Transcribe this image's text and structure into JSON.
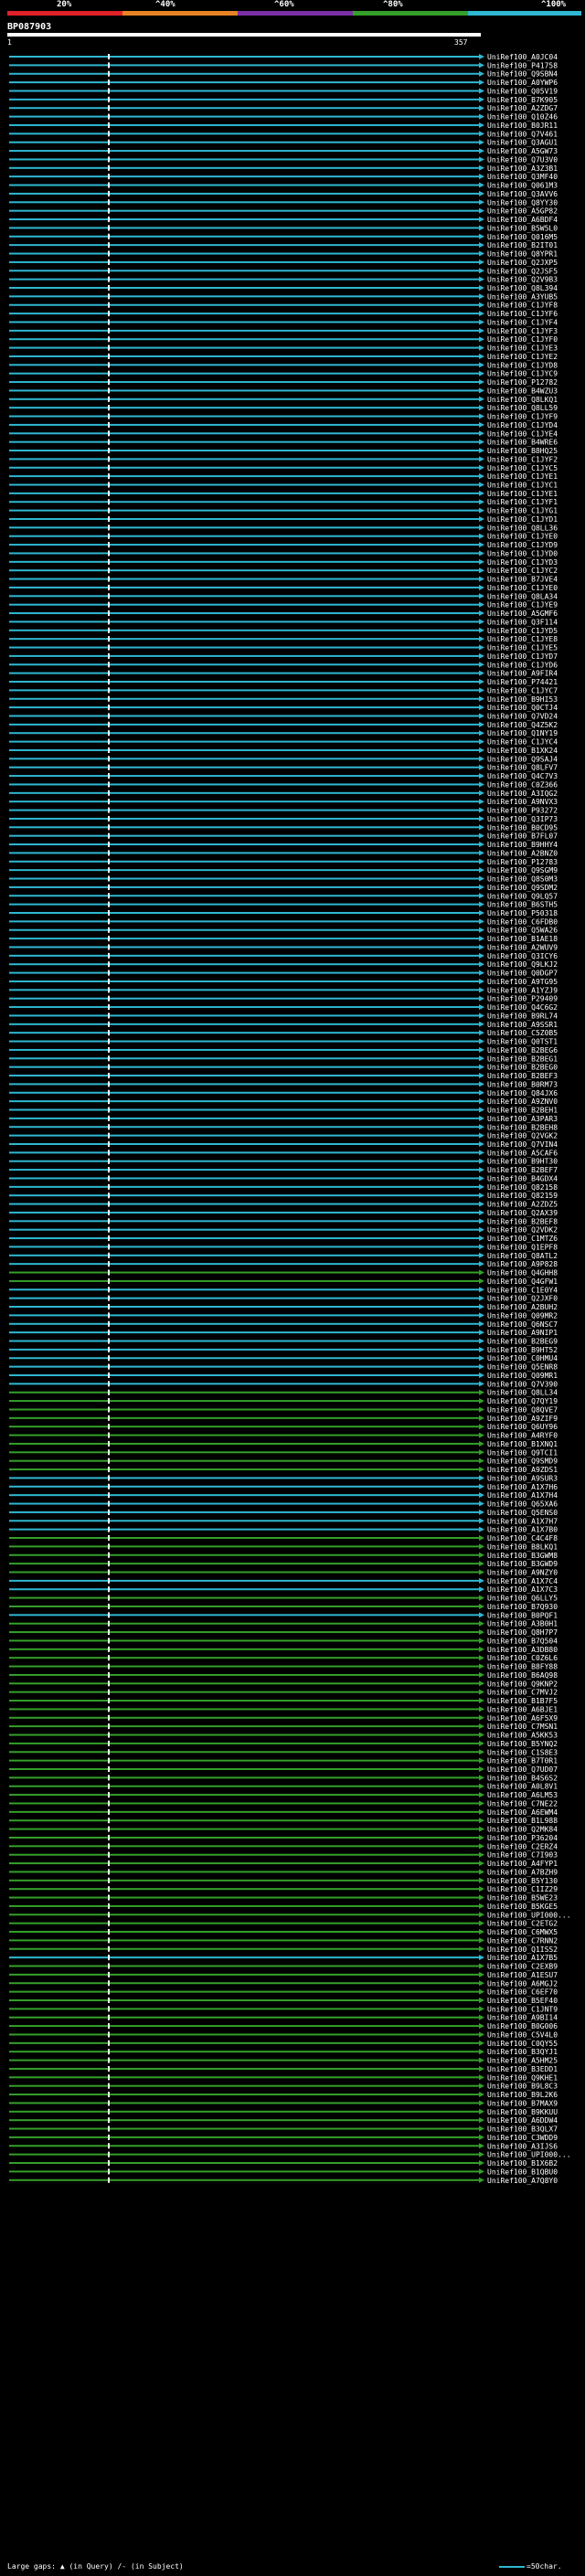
{
  "scale": {
    "labels": [
      "20%",
      "^40%",
      "^60%",
      "^80%",
      "^100%"
    ],
    "colors": [
      "#e1212a",
      "#e78324",
      "#7a2fa6",
      "#34a02a",
      "#2fb8d2"
    ]
  },
  "query": {
    "id": "BP087903",
    "start": "1",
    "end": "357"
  },
  "hits": [
    {
      "id": "UniRef100_A0JC04",
      "color": "cyan"
    },
    {
      "id": "UniRef100_P41758",
      "color": "cyan"
    },
    {
      "id": "UniRef100_Q9SBN4",
      "color": "cyan"
    },
    {
      "id": "UniRef100_A0YWP6",
      "color": "cyan"
    },
    {
      "id": "UniRef100_Q05V19",
      "color": "cyan"
    },
    {
      "id": "UniRef100_B7K905",
      "color": "cyan"
    },
    {
      "id": "UniRef100_A2ZDG7",
      "color": "cyan"
    },
    {
      "id": "UniRef100_Q10Z46",
      "color": "cyan"
    },
    {
      "id": "UniRef100_B0JR11",
      "color": "cyan"
    },
    {
      "id": "UniRef100_Q7V461",
      "color": "cyan"
    },
    {
      "id": "UniRef100_Q3AGU1",
      "color": "cyan"
    },
    {
      "id": "UniRef100_A5GW73",
      "color": "cyan"
    },
    {
      "id": "UniRef100_Q7U3V0",
      "color": "cyan"
    },
    {
      "id": "UniRef100_A3Z3B1",
      "color": "cyan"
    },
    {
      "id": "UniRef100_Q3MF40",
      "color": "cyan"
    },
    {
      "id": "UniRef100_Q061M3",
      "color": "cyan"
    },
    {
      "id": "UniRef100_Q3AVV6",
      "color": "cyan"
    },
    {
      "id": "UniRef100_Q8YY30",
      "color": "cyan"
    },
    {
      "id": "UniRef100_A5GP82",
      "color": "cyan"
    },
    {
      "id": "UniRef100_A6BDF4",
      "color": "cyan"
    },
    {
      "id": "UniRef100_B5W5L0",
      "color": "cyan"
    },
    {
      "id": "UniRef100_Q016M5",
      "color": "cyan"
    },
    {
      "id": "UniRef100_B2IT01",
      "color": "cyan"
    },
    {
      "id": "UniRef100_Q8YPR1",
      "color": "cyan"
    },
    {
      "id": "UniRef100_Q2JXP5",
      "color": "cyan"
    },
    {
      "id": "UniRef100_Q2JSF5",
      "color": "cyan"
    },
    {
      "id": "UniRef100_Q2V9B3",
      "color": "cyan"
    },
    {
      "id": "UniRef100_Q8L394",
      "color": "cyan"
    },
    {
      "id": "UniRef100_A3YUB5",
      "color": "cyan"
    },
    {
      "id": "UniRef100_C1JYF8",
      "color": "cyan"
    },
    {
      "id": "UniRef100_C1JYF6",
      "color": "cyan"
    },
    {
      "id": "UniRef100_C1JYF4",
      "color": "cyan"
    },
    {
      "id": "UniRef100_C1JYF3",
      "color": "cyan"
    },
    {
      "id": "UniRef100_C1JYF0",
      "color": "cyan"
    },
    {
      "id": "UniRef100_C1JYE3",
      "color": "cyan"
    },
    {
      "id": "UniRef100_C1JYE2",
      "color": "cyan"
    },
    {
      "id": "UniRef100_C1JYD8",
      "color": "cyan"
    },
    {
      "id": "UniRef100_C1JYC9",
      "color": "cyan"
    },
    {
      "id": "UniRef100_P12782",
      "color": "cyan"
    },
    {
      "id": "UniRef100_B4WZU3",
      "color": "cyan"
    },
    {
      "id": "UniRef100_Q8LKQ1",
      "color": "cyan"
    },
    {
      "id": "UniRef100_Q8LL59",
      "color": "cyan"
    },
    {
      "id": "UniRef100_C1JYF9",
      "color": "cyan"
    },
    {
      "id": "UniRef100_C1JYD4",
      "color": "cyan"
    },
    {
      "id": "UniRef100_C1JYE4",
      "color": "cyan"
    },
    {
      "id": "UniRef100_B4WRE6",
      "color": "cyan"
    },
    {
      "id": "UniRef100_B8HQ25",
      "color": "cyan"
    },
    {
      "id": "UniRef100_C1JYF2",
      "color": "cyan"
    },
    {
      "id": "UniRef100_C1JYC5",
      "color": "cyan"
    },
    {
      "id": "UniRef100_C1JYE1",
      "color": "cyan"
    },
    {
      "id": "UniRef100_C1JYC1",
      "color": "cyan"
    },
    {
      "id": "UniRef100_C1JYE1",
      "color": "cyan"
    },
    {
      "id": "UniRef100_C1JYF1",
      "color": "cyan"
    },
    {
      "id": "UniRef100_C1JYG1",
      "color": "cyan"
    },
    {
      "id": "UniRef100_C1JYD1",
      "color": "cyan"
    },
    {
      "id": "UniRef100_Q8LL36",
      "color": "cyan"
    },
    {
      "id": "UniRef100_C1JYE0",
      "color": "cyan"
    },
    {
      "id": "UniRef100_C1JYD9",
      "color": "cyan"
    },
    {
      "id": "UniRef100_C1JYD0",
      "color": "cyan"
    },
    {
      "id": "UniRef100_C1JYD3",
      "color": "cyan"
    },
    {
      "id": "UniRef100_C1JYC2",
      "color": "cyan"
    },
    {
      "id": "UniRef100_B7JVE4",
      "color": "cyan"
    },
    {
      "id": "UniRef100_C1JYE0",
      "color": "cyan"
    },
    {
      "id": "UniRef100_Q8LA34",
      "color": "cyan"
    },
    {
      "id": "UniRef100_C1JYE9",
      "color": "cyan"
    },
    {
      "id": "UniRef100_A5GMF6",
      "color": "cyan"
    },
    {
      "id": "UniRef100_Q3F114",
      "color": "cyan"
    },
    {
      "id": "UniRef100_C1JYD5",
      "color": "cyan"
    },
    {
      "id": "UniRef100_C1JYE8",
      "color": "cyan"
    },
    {
      "id": "UniRef100_C1JYE5",
      "color": "cyan"
    },
    {
      "id": "UniRef100_C1JYD7",
      "color": "cyan"
    },
    {
      "id": "UniRef100_C1JYD6",
      "color": "cyan"
    },
    {
      "id": "UniRef100_A9FIR4",
      "color": "cyan"
    },
    {
      "id": "UniRef100_P74421",
      "color": "cyan"
    },
    {
      "id": "UniRef100_C1JYC7",
      "color": "cyan"
    },
    {
      "id": "UniRef100_B9HI53",
      "color": "cyan"
    },
    {
      "id": "UniRef100_Q0CTJ4",
      "color": "cyan"
    },
    {
      "id": "UniRef100_Q7VD24",
      "color": "cyan"
    },
    {
      "id": "UniRef100_Q4Z5K2",
      "color": "cyan"
    },
    {
      "id": "UniRef100_Q1NY19",
      "color": "cyan"
    },
    {
      "id": "UniRef100_C1JYC4",
      "color": "cyan"
    },
    {
      "id": "UniRef100_B1XK24",
      "color": "cyan"
    },
    {
      "id": "UniRef100_Q9SAJ4",
      "color": "cyan"
    },
    {
      "id": "UniRef100_Q8LFV7",
      "color": "cyan"
    },
    {
      "id": "UniRef100_Q4C7V3",
      "color": "cyan"
    },
    {
      "id": "UniRef100_C0Z366",
      "color": "cyan"
    },
    {
      "id": "UniRef100_A3IQG2",
      "color": "cyan"
    },
    {
      "id": "UniRef100_A9NVX3",
      "color": "cyan"
    },
    {
      "id": "UniRef100_P93272",
      "color": "cyan"
    },
    {
      "id": "UniRef100_Q3IP73",
      "color": "cyan"
    },
    {
      "id": "UniRef100_B0CD95",
      "color": "cyan"
    },
    {
      "id": "UniRef100_B7FL07",
      "color": "cyan"
    },
    {
      "id": "UniRef100_B9HHY4",
      "color": "cyan"
    },
    {
      "id": "UniRef100_A2BNZ0",
      "color": "cyan"
    },
    {
      "id": "UniRef100_P12783",
      "color": "cyan"
    },
    {
      "id": "UniRef100_Q9SGM9",
      "color": "cyan"
    },
    {
      "id": "UniRef100_Q8S0M3",
      "color": "cyan"
    },
    {
      "id": "UniRef100_Q9SDM2",
      "color": "cyan"
    },
    {
      "id": "UniRef100_Q9LQ57",
      "color": "cyan"
    },
    {
      "id": "UniRef100_B6STH5",
      "color": "cyan"
    },
    {
      "id": "UniRef100_P50318",
      "color": "cyan"
    },
    {
      "id": "UniRef100_C6FDB0",
      "color": "cyan"
    },
    {
      "id": "UniRef100_Q5WA26",
      "color": "cyan"
    },
    {
      "id": "UniRef100_B1AE18",
      "color": "cyan"
    },
    {
      "id": "UniRef100_A2WUV9",
      "color": "cyan"
    },
    {
      "id": "UniRef100_Q3ICY6",
      "color": "cyan"
    },
    {
      "id": "UniRef100_Q9LKJ2",
      "color": "cyan"
    },
    {
      "id": "UniRef100_Q0DGP7",
      "color": "cyan"
    },
    {
      "id": "UniRef100_A9TG95",
      "color": "cyan"
    },
    {
      "id": "UniRef100_A1YZJ9",
      "color": "cyan"
    },
    {
      "id": "UniRef100_P29409",
      "color": "cyan"
    },
    {
      "id": "UniRef100_Q4C6G2",
      "color": "cyan"
    },
    {
      "id": "UniRef100_B9RL74",
      "color": "cyan"
    },
    {
      "id": "UniRef100_A9SSR1",
      "color": "cyan"
    },
    {
      "id": "UniRef100_C5Z0B5",
      "color": "cyan"
    },
    {
      "id": "UniRef100_Q0TST1",
      "color": "cyan"
    },
    {
      "id": "UniRef100_B2BEG6",
      "color": "cyan"
    },
    {
      "id": "UniRef100_B2BEG1",
      "color": "cyan"
    },
    {
      "id": "UniRef100_B2BEG0",
      "color": "cyan"
    },
    {
      "id": "UniRef100_B2BEF3",
      "color": "cyan"
    },
    {
      "id": "UniRef100_B0RM73",
      "color": "cyan"
    },
    {
      "id": "UniRef100_Q84JX6",
      "color": "cyan"
    },
    {
      "id": "UniRef100_A9ZNV0",
      "color": "cyan"
    },
    {
      "id": "UniRef100_B2BEH1",
      "color": "cyan"
    },
    {
      "id": "UniRef100_A3PAR3",
      "color": "cyan"
    },
    {
      "id": "UniRef100_B2BEH8",
      "color": "cyan"
    },
    {
      "id": "UniRef100_Q2VGK2",
      "color": "cyan"
    },
    {
      "id": "UniRef100_Q7VIN4",
      "color": "cyan"
    },
    {
      "id": "UniRef100_A5CAF6",
      "color": "cyan"
    },
    {
      "id": "UniRef100_B9HT30",
      "color": "cyan"
    },
    {
      "id": "UniRef100_B2BEF7",
      "color": "cyan"
    },
    {
      "id": "UniRef100_B4GDX4",
      "color": "cyan"
    },
    {
      "id": "UniRef100_Q82158",
      "color": "cyan"
    },
    {
      "id": "UniRef100_Q82159",
      "color": "cyan"
    },
    {
      "id": "UniRef100_A2ZDZ5",
      "color": "cyan"
    },
    {
      "id": "UniRef100_Q2AX39",
      "color": "cyan"
    },
    {
      "id": "UniRef100_B2BEF8",
      "color": "cyan"
    },
    {
      "id": "UniRef100_Q2VDK2",
      "color": "cyan"
    },
    {
      "id": "UniRef100_C1MTZ6",
      "color": "cyan"
    },
    {
      "id": "UniRef100_Q1EPF8",
      "color": "cyan"
    },
    {
      "id": "UniRef100_Q8ATL2",
      "color": "cyan"
    },
    {
      "id": "UniRef100_A9P828",
      "color": "cyan"
    },
    {
      "id": "UniRef100_Q4GHH8",
      "color": "green"
    },
    {
      "id": "UniRef100_Q4GFW1",
      "color": "green"
    },
    {
      "id": "UniRef100_C1E0Y4",
      "color": "cyan"
    },
    {
      "id": "UniRef100_Q2JXF0",
      "color": "cyan"
    },
    {
      "id": "UniRef100_A2BUH2",
      "color": "cyan"
    },
    {
      "id": "UniRef100_Q09MR2",
      "color": "cyan"
    },
    {
      "id": "UniRef100_Q6NSC7",
      "color": "cyan"
    },
    {
      "id": "UniRef100_A9NIP1",
      "color": "cyan"
    },
    {
      "id": "UniRef100_B2BEG9",
      "color": "cyan"
    },
    {
      "id": "UniRef100_B9HT52",
      "color": "cyan"
    },
    {
      "id": "UniRef100_C0HMU4",
      "color": "cyan"
    },
    {
      "id": "UniRef100_Q5ENR8",
      "color": "cyan"
    },
    {
      "id": "UniRef100_Q09MR1",
      "color": "cyan"
    },
    {
      "id": "UniRef100_Q7V390",
      "color": "cyan"
    },
    {
      "id": "UniRef100_Q8LL34",
      "color": "green"
    },
    {
      "id": "UniRef100_Q7QY19",
      "color": "green"
    },
    {
      "id": "UniRef100_Q8QVE7",
      "color": "green"
    },
    {
      "id": "UniRef100_A9ZIF9",
      "color": "green"
    },
    {
      "id": "UniRef100_Q6UY96",
      "color": "green"
    },
    {
      "id": "UniRef100_A4RYF0",
      "color": "green"
    },
    {
      "id": "UniRef100_B1XNQ1",
      "color": "green"
    },
    {
      "id": "UniRef100_Q9TCI1",
      "color": "green"
    },
    {
      "id": "UniRef100_Q9SMD9",
      "color": "green"
    },
    {
      "id": "UniRef100_A9ZDS1",
      "color": "green"
    },
    {
      "id": "UniRef100_A9SUR3",
      "color": "cyan"
    },
    {
      "id": "UniRef100_A1X7H6",
      "color": "cyan"
    },
    {
      "id": "UniRef100_A1X7H4",
      "color": "cyan"
    },
    {
      "id": "UniRef100_Q65XA6",
      "color": "cyan"
    },
    {
      "id": "UniRef100_Q5ENS0",
      "color": "cyan"
    },
    {
      "id": "UniRef100_A1X7H7",
      "color": "cyan"
    },
    {
      "id": "UniRef100_A1X7B0",
      "color": "cyan"
    },
    {
      "id": "UniRef100_C4C4F8",
      "color": "green"
    },
    {
      "id": "UniRef100_B8LKQ1",
      "color": "green"
    },
    {
      "id": "UniRef100_B3GWM8",
      "color": "green"
    },
    {
      "id": "UniRef100_B3GWD9",
      "color": "green"
    },
    {
      "id": "UniRef100_A9NZY0",
      "color": "green"
    },
    {
      "id": "UniRef100_A1X7C4",
      "color": "cyan"
    },
    {
      "id": "UniRef100_A1X7C3",
      "color": "cyan"
    },
    {
      "id": "UniRef100_Q6LLY5",
      "color": "green"
    },
    {
      "id": "UniRef100_B7Q930",
      "color": "green"
    },
    {
      "id": "UniRef100_B0PQF1",
      "color": "cyan"
    },
    {
      "id": "UniRef100_A3B0H1",
      "color": "green"
    },
    {
      "id": "UniRef100_Q8H7P7",
      "color": "green"
    },
    {
      "id": "UniRef100_B7Q504",
      "color": "green"
    },
    {
      "id": "UniRef100_A3DB80",
      "color": "green"
    },
    {
      "id": "UniRef100_C0Z6L6",
      "color": "green"
    },
    {
      "id": "UniRef100_B8FY88",
      "color": "green"
    },
    {
      "id": "UniRef100_B6AQ98",
      "color": "green"
    },
    {
      "id": "UniRef100_Q9KNP2",
      "color": "green"
    },
    {
      "id": "UniRef100_C7MVJ2",
      "color": "green"
    },
    {
      "id": "UniRef100_B1B7F5",
      "color": "green"
    },
    {
      "id": "UniRef100_A6BJE1",
      "color": "green"
    },
    {
      "id": "UniRef100_A6F5X9",
      "color": "green"
    },
    {
      "id": "UniRef100_C7MSN1",
      "color": "green"
    },
    {
      "id": "UniRef100_A5KK53",
      "color": "green"
    },
    {
      "id": "UniRef100_B5YNQ2",
      "color": "green"
    },
    {
      "id": "UniRef100_C1S8E3",
      "color": "green"
    },
    {
      "id": "UniRef100_B7T0R1",
      "color": "green"
    },
    {
      "id": "UniRef100_Q7UD07",
      "color": "green"
    },
    {
      "id": "UniRef100_B4S6S2",
      "color": "green"
    },
    {
      "id": "UniRef100_A0L8V1",
      "color": "green"
    },
    {
      "id": "UniRef100_A6LM53",
      "color": "green"
    },
    {
      "id": "UniRef100_C7NE22",
      "color": "green"
    },
    {
      "id": "UniRef100_A6EWM4",
      "color": "green"
    },
    {
      "id": "UniRef100_B1L988",
      "color": "green"
    },
    {
      "id": "UniRef100_Q2MK84",
      "color": "green"
    },
    {
      "id": "UniRef100_P36204",
      "color": "green"
    },
    {
      "id": "UniRef100_C2ERZ4",
      "color": "green"
    },
    {
      "id": "UniRef100_C7I903",
      "color": "green"
    },
    {
      "id": "UniRef100_A4FYP1",
      "color": "green"
    },
    {
      "id": "UniRef100_A7BZH9",
      "color": "green"
    },
    {
      "id": "UniRef100_B5Y130",
      "color": "green"
    },
    {
      "id": "UniRef100_C1IZ29",
      "color": "green"
    },
    {
      "id": "UniRef100_B5WE23",
      "color": "green"
    },
    {
      "id": "UniRef100_B5KGE5",
      "color": "green"
    },
    {
      "id": "UniRef100_UPI000...",
      "color": "green"
    },
    {
      "id": "UniRef100_C2ETG2",
      "color": "green"
    },
    {
      "id": "UniRef100_C6MWX5",
      "color": "green"
    },
    {
      "id": "UniRef100_C7RNN2",
      "color": "green"
    },
    {
      "id": "UniRef100_Q1ISS2",
      "color": "green"
    },
    {
      "id": "UniRef100_A1X7B5",
      "color": "cyan"
    },
    {
      "id": "UniRef100_C2EXB9",
      "color": "green"
    },
    {
      "id": "UniRef100_A1ESU7",
      "color": "green"
    },
    {
      "id": "UniRef100_A6MGJ2",
      "color": "green"
    },
    {
      "id": "UniRef100_C6EF70",
      "color": "green"
    },
    {
      "id": "UniRef100_B5EF40",
      "color": "green"
    },
    {
      "id": "UniRef100_C1JNT9",
      "color": "green"
    },
    {
      "id": "UniRef100_A9BI14",
      "color": "green"
    },
    {
      "id": "UniRef100_B0G006",
      "color": "green"
    },
    {
      "id": "UniRef100_C5V4L0",
      "color": "green"
    },
    {
      "id": "UniRef100_C0QY55",
      "color": "green"
    },
    {
      "id": "UniRef100_B3QYJ1",
      "color": "green"
    },
    {
      "id": "UniRef100_A5HM25",
      "color": "green"
    },
    {
      "id": "UniRef100_B3EDD1",
      "color": "green"
    },
    {
      "id": "UniRef100_Q9KHE1",
      "color": "green"
    },
    {
      "id": "UniRef100_B9L8C3",
      "color": "green"
    },
    {
      "id": "UniRef100_B9L2K6",
      "color": "green"
    },
    {
      "id": "UniRef100_B7MAX9",
      "color": "green"
    },
    {
      "id": "UniRef100_B9KKUU",
      "color": "green"
    },
    {
      "id": "UniRef100_A6DDW4",
      "color": "green"
    },
    {
      "id": "UniRef100_B3QLX7",
      "color": "green"
    },
    {
      "id": "UniRef100_C3WDD9",
      "color": "green"
    },
    {
      "id": "UniRef100_A3IJS6",
      "color": "green"
    },
    {
      "id": "UniRef100_UPI000...",
      "color": "green"
    },
    {
      "id": "UniRef100_B1X6B2",
      "color": "green"
    },
    {
      "id": "UniRef100_B1QBU0",
      "color": "green"
    },
    {
      "id": "UniRef100_A7Q8Y0",
      "color": "green"
    }
  ],
  "footer": {
    "gaps_label": "Large gaps:",
    "query_gap_label": "(in Query)",
    "subject_gap_label": "(in Subject)",
    "scale_label": "=50char."
  }
}
